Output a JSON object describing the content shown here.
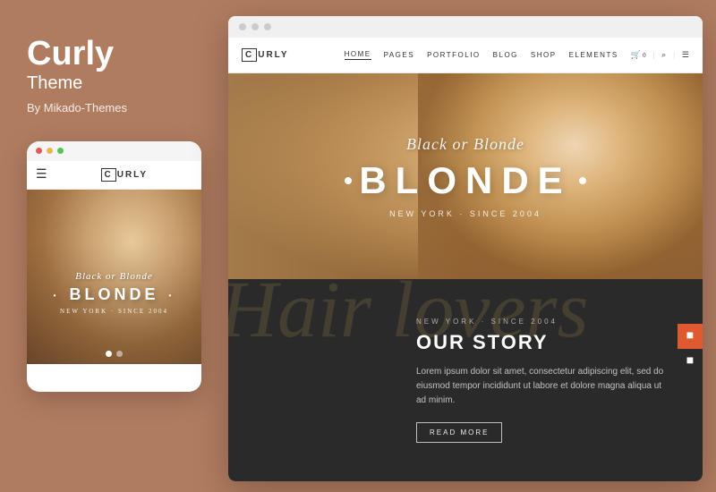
{
  "brand": {
    "title": "Curly",
    "subtitle": "Theme",
    "by": "By Mikado-Themes"
  },
  "mobile": {
    "logo_text": "URLY",
    "logo_c": "C",
    "hero_script": "Black or Blonde",
    "hero_main": "BLONDE",
    "hero_since": "NEW YORK · SINCE 2004",
    "bullet": "•"
  },
  "desktop": {
    "logo_c": "C",
    "logo_text": "URLY",
    "nav_links": [
      {
        "label": "HOME",
        "active": true
      },
      {
        "label": "PAGES",
        "active": false
      },
      {
        "label": "PORTFOLIO",
        "active": false
      },
      {
        "label": "BLOG",
        "active": false
      },
      {
        "label": "SHOP",
        "active": false
      },
      {
        "label": "ELEMENTS",
        "active": false
      }
    ],
    "hero_script": "Black or Blonde",
    "hero_main": "BLONDE",
    "hero_since": "NEW YORK · SINCE 2004",
    "dark_tag": "NEW YORK · SINCE 2004",
    "dark_heading": "OUR STORY",
    "dark_script_bg": "Hair  lovers",
    "dark_body": "Lorem ipsum dolor sit amet, consectetur adipiscing elit, sed do eiusmod tempor incididunt ut labore et dolore magna aliqua ut ad minim.",
    "dark_button": "READ MORE",
    "cart_count": "0"
  },
  "colors": {
    "background": "#b07c60",
    "white": "#ffffff",
    "dark": "#2a2a2a",
    "accent_gold": "#b89050"
  }
}
